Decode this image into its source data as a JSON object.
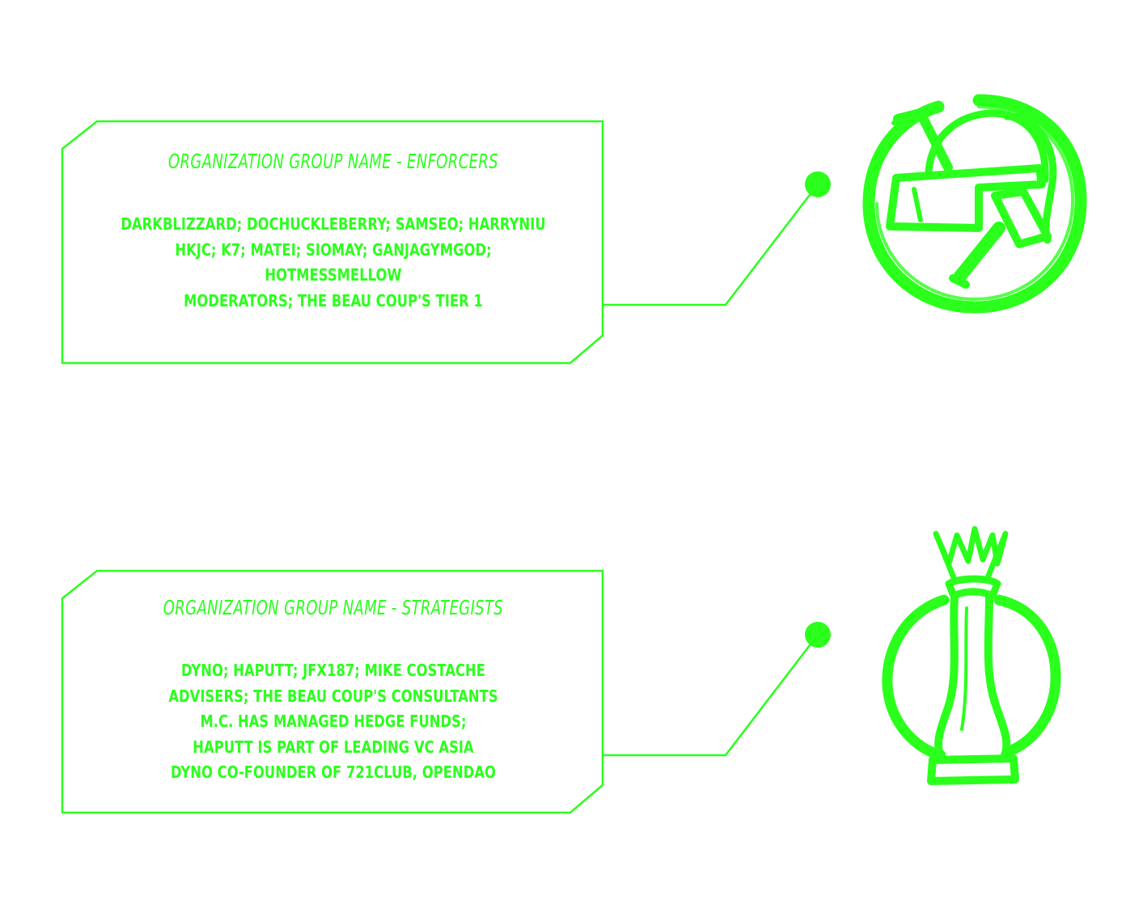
{
  "accent_color": "#2bff1c",
  "groups": [
    {
      "title": "Organization Group Name - Enforcers",
      "lines": [
        "DarkBlizzard; Dochuckleberry; Samseo; Harryniu",
        "HKJC; K7; Matei; Siomay; GanjaGymGod;",
        "Hotmessmellow",
        "Moderators; The Beau Coup's Tier 1"
      ],
      "icon": "helmet-and-trowel-icon"
    },
    {
      "title": "Organization Group Name - Strategists",
      "lines": [
        "Dyno; Haputt; Jfx187; Mike Costache",
        "Advisers; The Beau Coup's Consultants",
        "M.C. has managed Hedge Funds;",
        "Haputt is part of leading VC Asia",
        "Dyno co-founder of 721club, OpenDAO"
      ],
      "icon": "chess-queen-icon"
    }
  ]
}
